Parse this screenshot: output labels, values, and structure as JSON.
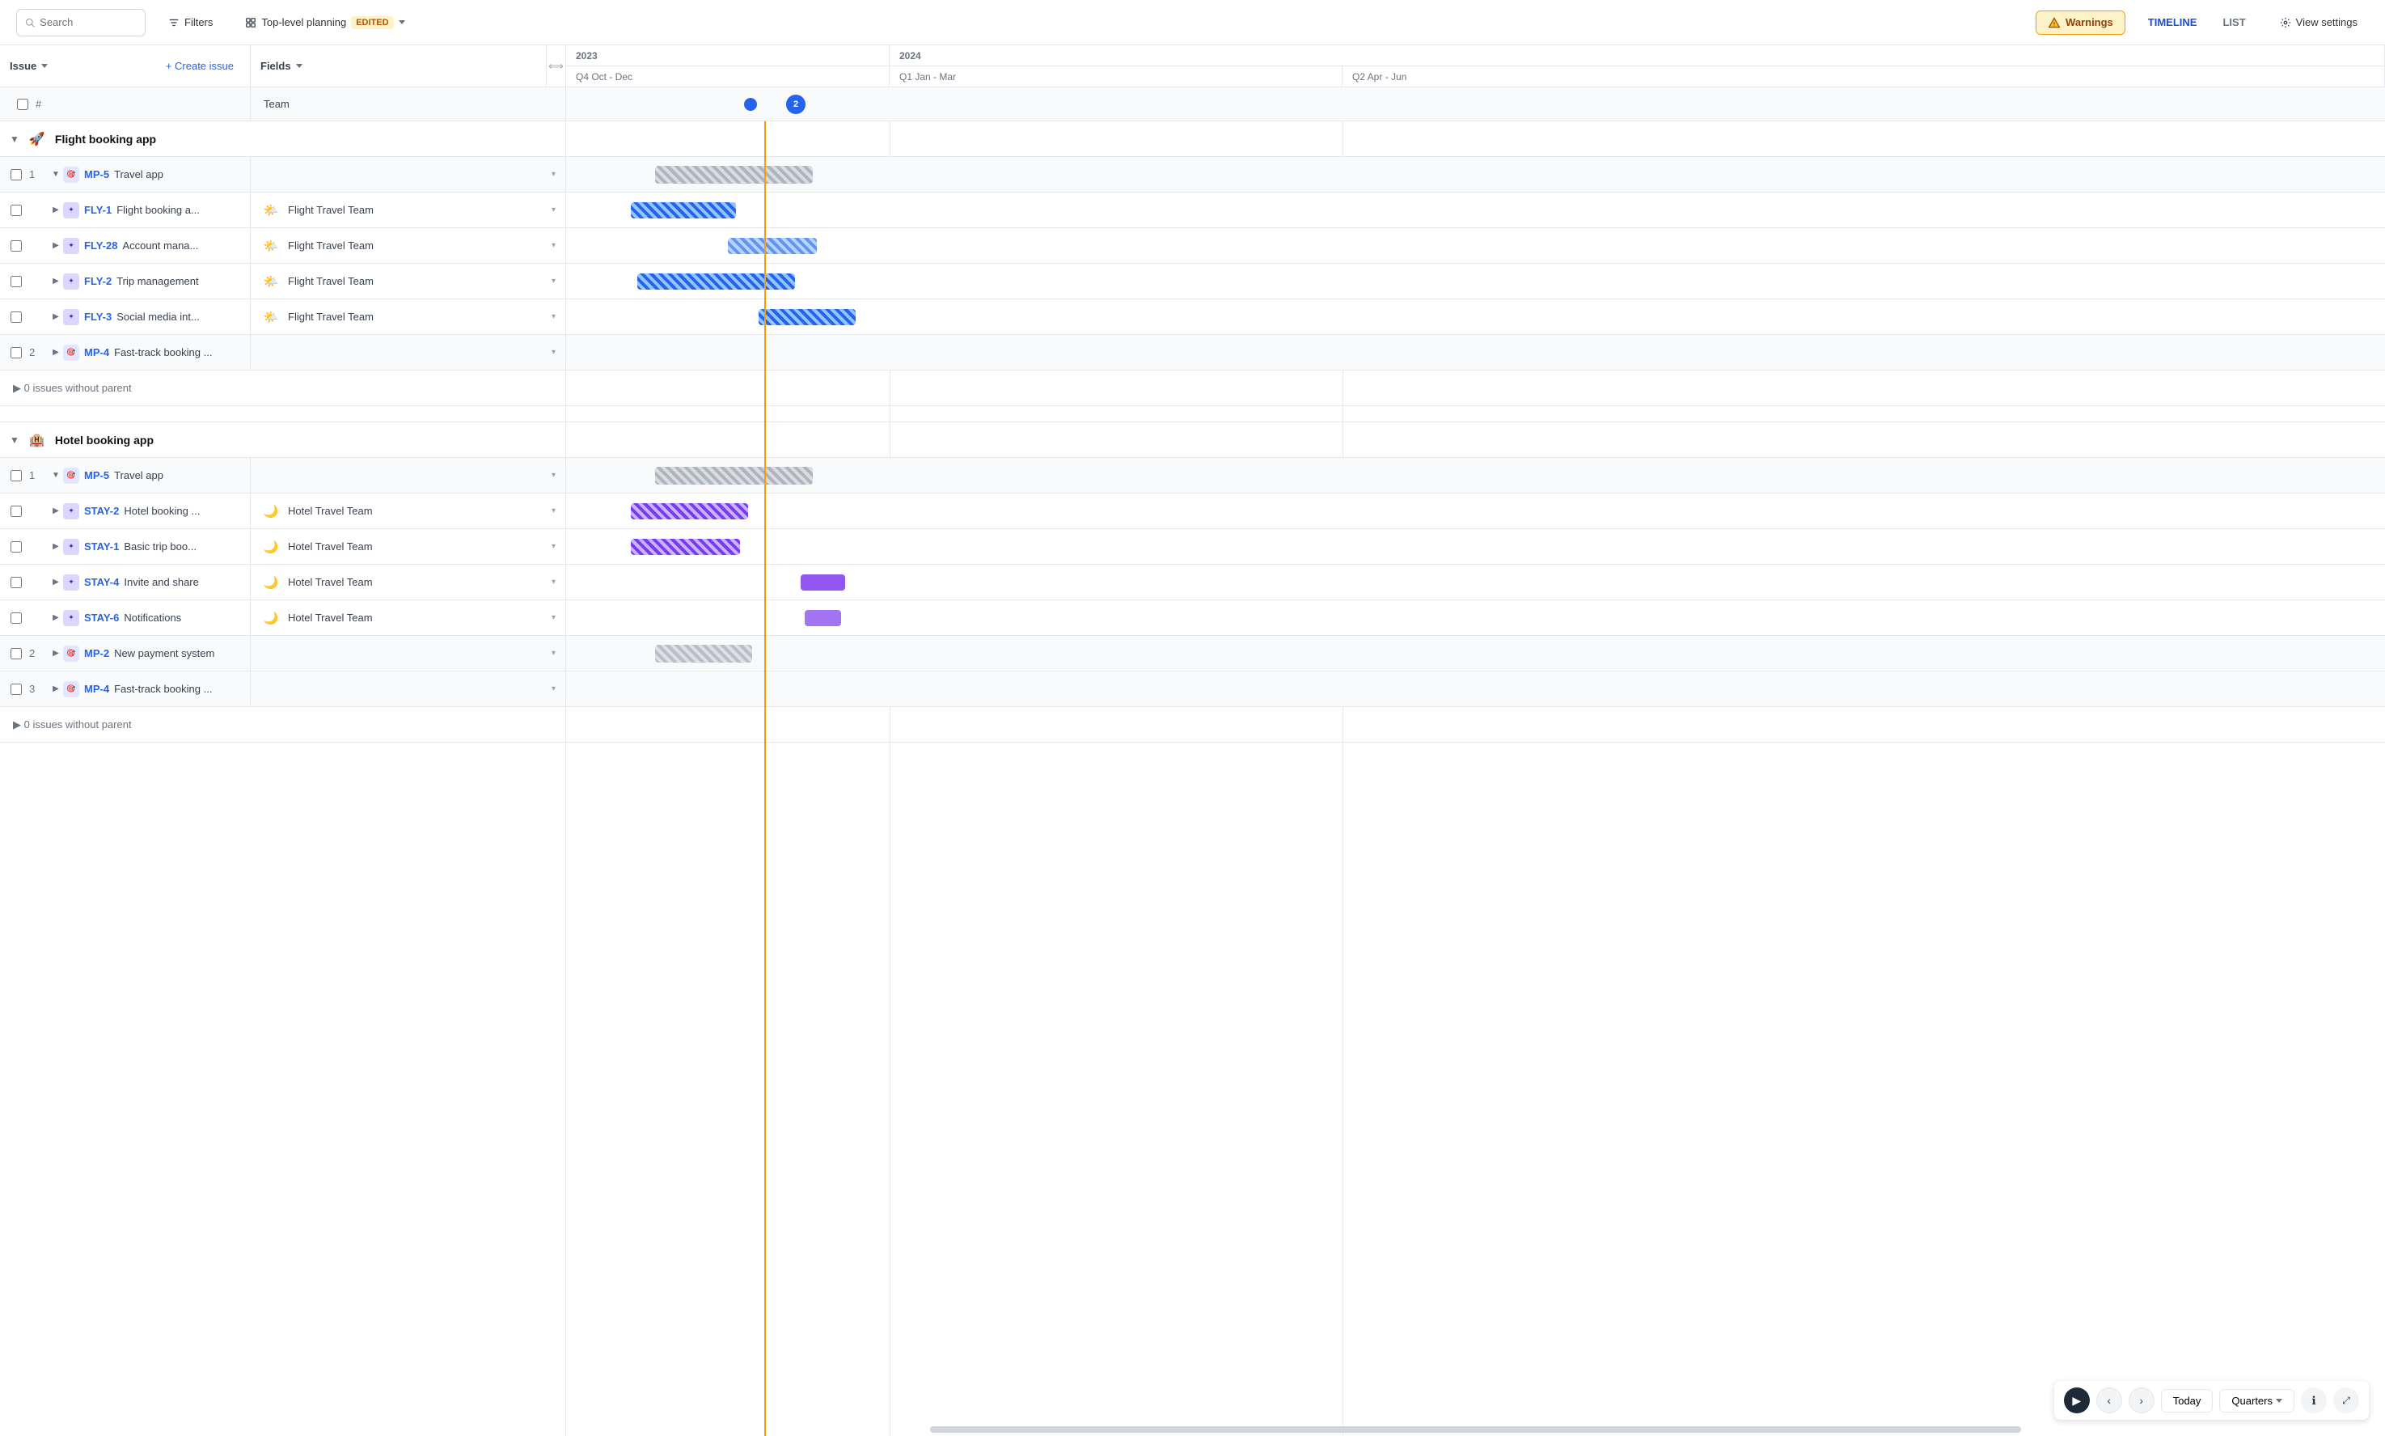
{
  "toolbar": {
    "search_placeholder": "Search",
    "filters_label": "Filters",
    "top_level_label": "Top-level planning",
    "edited_badge": "EDITED",
    "warnings_label": "Warnings",
    "timeline_label": "TIMELINE",
    "list_label": "LIST",
    "view_settings_label": "View settings"
  },
  "columns": {
    "issue_label": "Issue",
    "create_issue_label": "+ Create issue",
    "fields_label": "Fields",
    "year_2023": "2023",
    "year_2024": "2024",
    "q4": "Q4 Oct - Dec",
    "q1": "Q1 Jan - Mar",
    "q2": "Q2 Apr - Jun"
  },
  "subheader": {
    "hash": "#",
    "team_label": "Team"
  },
  "groups": [
    {
      "id": "flight-group",
      "emoji": "🚀",
      "title": "Flight booking app",
      "parents": [
        {
          "num": "1",
          "icon_type": "mp",
          "id": "MP-5",
          "title": "Travel app",
          "children": [
            {
              "icon_type": "fly",
              "id": "FLY-1",
              "title": "Flight booking a...",
              "team": "Flight Travel Team",
              "team_emoji": "🌤️"
            },
            {
              "icon_type": "fly",
              "id": "FLY-28",
              "title": "Account mana...",
              "team": "Flight Travel Team",
              "team_emoji": "🌤️"
            },
            {
              "icon_type": "fly",
              "id": "FLY-2",
              "title": "Trip management",
              "team": "Flight Travel Team",
              "team_emoji": "🌤️"
            },
            {
              "icon_type": "fly",
              "id": "FLY-3",
              "title": "Social media int...",
              "team": "Flight Travel Team",
              "team_emoji": "🌤️"
            }
          ]
        },
        {
          "num": "2",
          "icon_type": "mp",
          "id": "MP-4",
          "title": "Fast-track booking ...",
          "children": []
        }
      ],
      "orphan_label": "> 0 issues without parent"
    },
    {
      "id": "hotel-group",
      "emoji": "🏨",
      "title": "Hotel booking app",
      "parents": [
        {
          "num": "1",
          "icon_type": "mp",
          "id": "MP-5",
          "title": "Travel app",
          "children": [
            {
              "icon_type": "stay",
              "id": "STAY-2",
              "title": "Hotel booking ...",
              "team": "Hotel Travel Team",
              "team_emoji": "🌙"
            },
            {
              "icon_type": "stay",
              "id": "STAY-1",
              "title": "Basic trip boo...",
              "team": "Hotel Travel Team",
              "team_emoji": "🌙"
            },
            {
              "icon_type": "stay",
              "id": "STAY-4",
              "title": "Invite and share",
              "team": "Hotel Travel Team",
              "team_emoji": "🌙"
            },
            {
              "icon_type": "stay",
              "id": "STAY-6",
              "title": "Notifications",
              "team": "Hotel Travel Team",
              "team_emoji": "🌙"
            }
          ]
        },
        {
          "num": "2",
          "icon_type": "mp",
          "id": "MP-2",
          "title": "New payment system",
          "children": []
        },
        {
          "num": "3",
          "icon_type": "mp",
          "id": "MP-4",
          "title": "Fast-track booking ...",
          "children": []
        }
      ],
      "orphan_label": "> 0 issues without parent"
    }
  ],
  "bottom_nav": {
    "today_label": "Today",
    "quarters_label": "Quarters"
  }
}
